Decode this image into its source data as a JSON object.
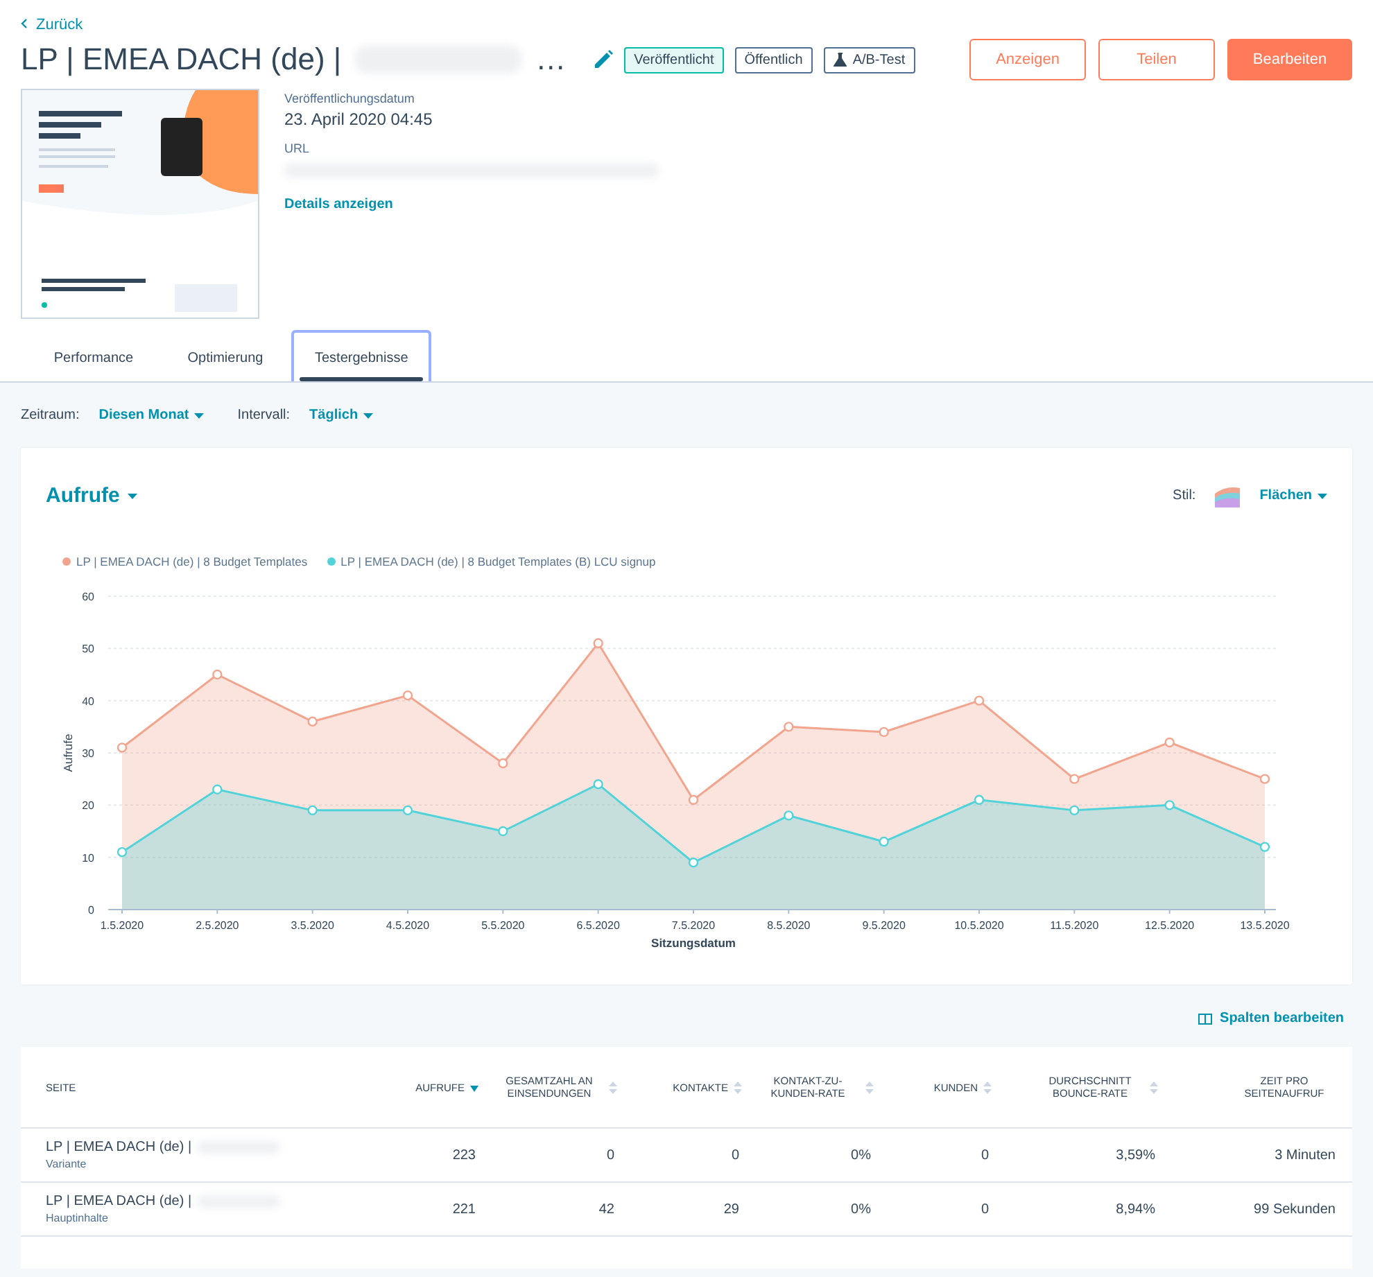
{
  "back_link": "Zurück",
  "page_title": "LP | EMEA DACH (de) |",
  "title_ellipsis": "…",
  "badges": [
    {
      "label": "Veröffentlicht",
      "kind": "status"
    },
    {
      "label": "Öffentlich",
      "kind": "plain"
    },
    {
      "label": "A/B-Test",
      "kind": "flask"
    }
  ],
  "actions": [
    {
      "label": "Anzeigen",
      "kind": "secondary"
    },
    {
      "label": "Teilen",
      "kind": "secondary"
    },
    {
      "label": "Bearbeiten",
      "kind": "primary"
    }
  ],
  "details": {
    "date_label": "Veröffentlichungsdatum",
    "date_value": "23. April 2020 04:45",
    "url_label": "URL",
    "link": "Details anzeigen"
  },
  "tabs": [
    {
      "label": "Performance",
      "selected": false
    },
    {
      "label": "Optimierung",
      "selected": false
    },
    {
      "label": "Testergebnisse",
      "selected": true
    }
  ],
  "filters": [
    {
      "label": "Zeitraum:",
      "value": "Diesen Monat"
    },
    {
      "label": "Intervall:",
      "value": "Täglich"
    }
  ],
  "chart_card": {
    "metric": "Aufrufe",
    "style_label": "Stil:",
    "style_value": "Flächen",
    "chart_data": {
      "type": "area",
      "xlabel": "Sitzungsdatum",
      "ylabel": "Aufrufe",
      "categories": [
        "1.5.2020",
        "2.5.2020",
        "3.5.2020",
        "4.5.2020",
        "5.5.2020",
        "6.5.2020",
        "7.5.2020",
        "8.5.2020",
        "9.5.2020",
        "10.5.2020",
        "11.5.2020",
        "12.5.2020",
        "13.5.2020"
      ],
      "ylim": [
        0,
        60
      ],
      "yticks": [
        0,
        10,
        20,
        30,
        40,
        50,
        60
      ],
      "stacked": false,
      "grid": true,
      "series": [
        {
          "name": "LP | EMEA DACH (de) | 8 Budget Templates",
          "color": "#f2a58e",
          "values": [
            31,
            45,
            36,
            41,
            28,
            51,
            21,
            35,
            34,
            40,
            25,
            32,
            25
          ]
        },
        {
          "name": "LP | EMEA DACH (de) | 8 Budget Templates (B) LCU signup",
          "color": "#51d3d9",
          "values": [
            11,
            23,
            19,
            19,
            15,
            24,
            9,
            18,
            13,
            21,
            19,
            20,
            12
          ]
        }
      ]
    }
  },
  "edit_columns": "Spalten bearbeiten",
  "table": {
    "columns": [
      {
        "label": "SEITE",
        "sortable": false
      },
      {
        "label": "AUFRUFE",
        "sortable": true,
        "sorted": true
      },
      {
        "label": "GESAMTZAHL AN EINSENDUNGEN",
        "sortable": true,
        "sorted": false
      },
      {
        "label": "KONTAKTE",
        "sortable": true,
        "sorted": false
      },
      {
        "label": "KONTAKT-ZU-KUNDEN-RATE",
        "sortable": true,
        "sorted": false
      },
      {
        "label": "KUNDEN",
        "sortable": true,
        "sorted": false
      },
      {
        "label": "DURCHSCHNITT BOUNCE-RATE",
        "sortable": true,
        "sorted": false
      },
      {
        "label": "ZEIT PRO SEITENAUFRUF",
        "sortable": false
      }
    ],
    "rows": [
      {
        "page": "LP | EMEA DACH (de) |",
        "type": "Variante",
        "cells": [
          "223",
          "0",
          "0",
          "0%",
          "0",
          "3,59%",
          "3 Minuten"
        ]
      },
      {
        "page": "LP | EMEA DACH (de) |",
        "type": "Hauptinhalte",
        "cells": [
          "221",
          "42",
          "29",
          "0%",
          "0",
          "8,94%",
          "99 Sekunden"
        ]
      }
    ]
  }
}
